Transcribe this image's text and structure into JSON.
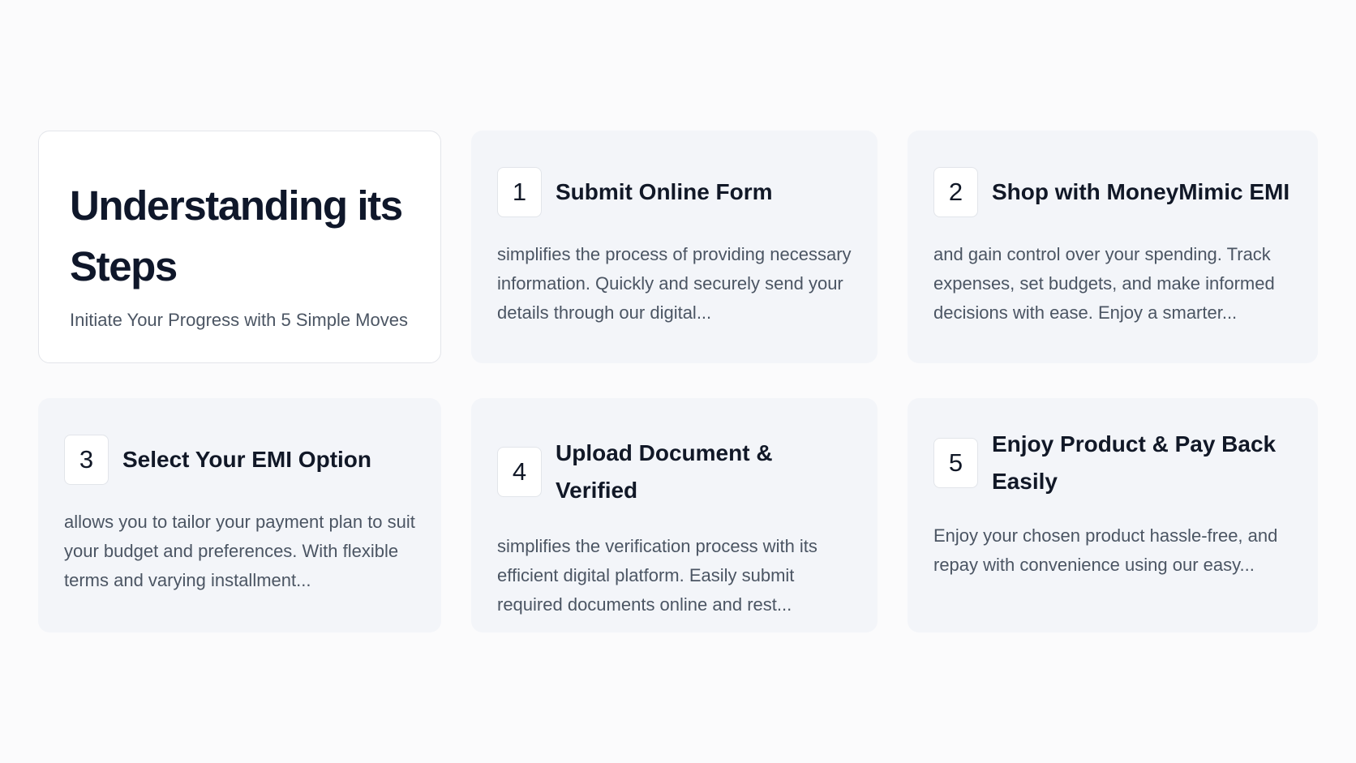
{
  "intro": {
    "title": "Understanding its Steps",
    "subtitle": "Initiate Your Progress with 5 Simple Moves"
  },
  "steps": [
    {
      "number": "1",
      "title": "Submit Online Form",
      "description": "simplifies the process of providing necessary information. Quickly and securely send your details through our digital..."
    },
    {
      "number": "2",
      "title": "Shop with MoneyMimic EMI",
      "description": "and gain control over your spending. Track expenses, set budgets, and make informed decisions with ease. Enjoy a smarter..."
    },
    {
      "number": "3",
      "title": "Select Your EMI Option",
      "description": "allows you to tailor your payment plan to suit your budget and preferences. With flexible terms and varying installment..."
    },
    {
      "number": "4",
      "title": "Upload Document & Verified",
      "description": "simplifies the verification process with its efficient digital platform. Easily submit required documents online and rest..."
    },
    {
      "number": "5",
      "title": "Enjoy Product & Pay Back Easily",
      "description": "Enjoy your chosen product hassle-free, and repay with convenience using our easy..."
    }
  ]
}
